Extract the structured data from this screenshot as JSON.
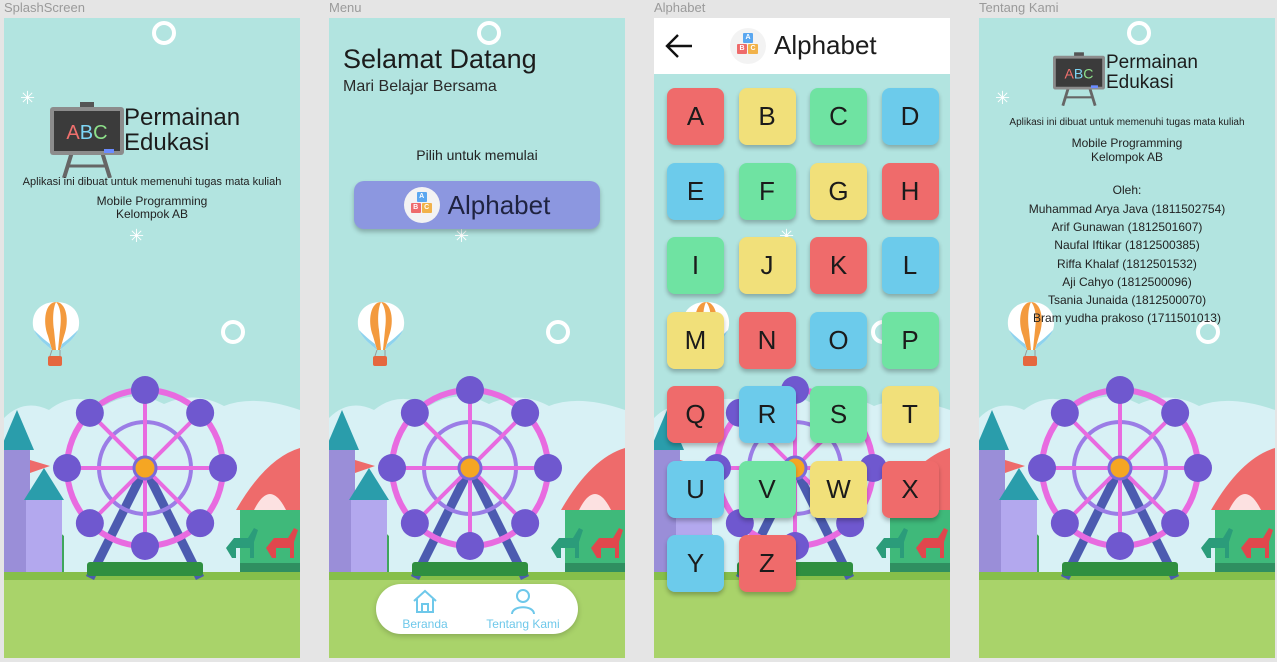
{
  "frames": {
    "splash": {
      "label": "SplashScreen"
    },
    "menu": {
      "label": "Menu"
    },
    "alphabet": {
      "label": "Alphabet"
    },
    "about": {
      "label": "Tentang Kami"
    }
  },
  "logo": {
    "board_text": "ABC",
    "line1": "Permainan",
    "line2": "Edukasi"
  },
  "splash": {
    "description": "Aplikasi ini dibuat untuk memenuhi tugas mata kuliah",
    "course": "Mobile Programming",
    "group": "Kelompok AB"
  },
  "menu": {
    "title": "Selamat Datang",
    "subtitle": "Mari Belajar Bersama",
    "prompt": "Pilih untuk memulai",
    "alphabet_button": "Alphabet",
    "nav": {
      "home": "Beranda",
      "about": "Tentang Kami"
    }
  },
  "alphabet": {
    "header_title": "Alphabet",
    "letters": [
      "A",
      "B",
      "C",
      "D",
      "E",
      "F",
      "G",
      "H",
      "I",
      "J",
      "K",
      "L",
      "M",
      "N",
      "O",
      "P",
      "Q",
      "R",
      "S",
      "T",
      "U",
      "V",
      "W",
      "X",
      "Y",
      "Z"
    ]
  },
  "about": {
    "description": "Aplikasi ini dibuat untuk memenuhi tugas mata kuliah",
    "course": "Mobile Programming",
    "group": "Kelompok AB",
    "by_label": "Oleh:",
    "members": [
      "Muhammad Arya Java (1811502754)",
      "Arif Gunawan (1812501607)",
      "Naufal Iftikar (1812500385)",
      "Riffa Khalaf (1812501532)",
      "Aji Cahyo (1812500096)",
      "Tsania Junaida (1812500070)",
      "Bram yudha prakoso (1711501013)"
    ]
  },
  "colors": {
    "background": "#b2e4e0",
    "button": "#8c97e0",
    "tile_red": "#ef6b6b",
    "tile_yellow": "#f1e07a",
    "tile_green": "#6fe3a2",
    "tile_blue": "#6ccbeb",
    "nav_accent": "#6ec8ea"
  }
}
